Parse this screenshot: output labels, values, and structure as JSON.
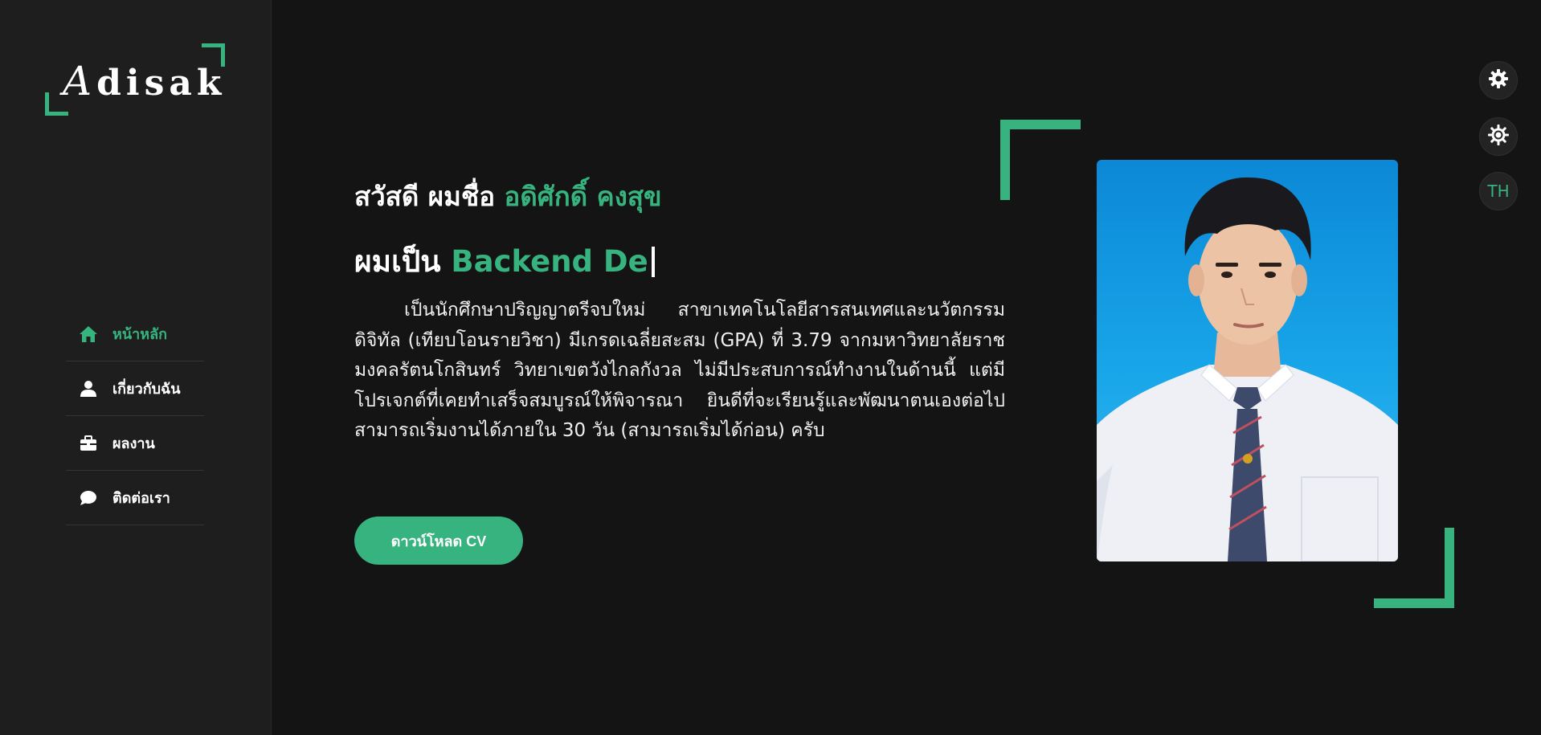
{
  "logo": {
    "first_letter": "A",
    "rest": "disak"
  },
  "nav": [
    {
      "label": "หน้าหลัก",
      "icon": "home-icon",
      "active": true
    },
    {
      "label": "เกี่ยวกับฉัน",
      "icon": "user-icon",
      "active": false
    },
    {
      "label": "ผลงาน",
      "icon": "briefcase-icon",
      "active": false
    },
    {
      "label": "ติดต่อเรา",
      "icon": "chat-bubble-icon",
      "active": false
    }
  ],
  "hero": {
    "greeting_prefix": "สวัสดี ผมชื่อ",
    "name": "อดิศักดิ์ คงสุข",
    "role_prefix": "ผมเป็น",
    "role_typed": "Backend De",
    "bio": "เป็นนักศึกษาปริญญาตรีจบใหม่ สาขาเทคโนโลยีสารสนเทศและนวัตกรรมดิจิทัล (เทียบโอนรายวิชา) มีเกรดเฉลี่ยสะสม (GPA) ที่ 3.79 จากมหาวิทยาลัยราชมงคลรัตนโกสินทร์ วิทยาเขตวังไกลกังวล ไม่มีประสบการณ์ทำงานในด้านนี้ แต่มีโปรเจกต์ที่เคยทำเสร็จสมบูรณ์ให้พิจารณา ยินดีที่จะเรียนรู้และพัฒนาตนเองต่อไป สามารถเริ่มงานได้ภายใน 30 วัน (สามารถเริ่มได้ก่อน) ครับ",
    "cv_button": "ดาวน์โหลด CV"
  },
  "controls": {
    "settings_icon": "gear-icon",
    "theme_icon": "sun-icon",
    "language": "TH"
  },
  "colors": {
    "accent": "#36b37e",
    "background": "#141414",
    "sidebar": "#1e1e1e"
  }
}
